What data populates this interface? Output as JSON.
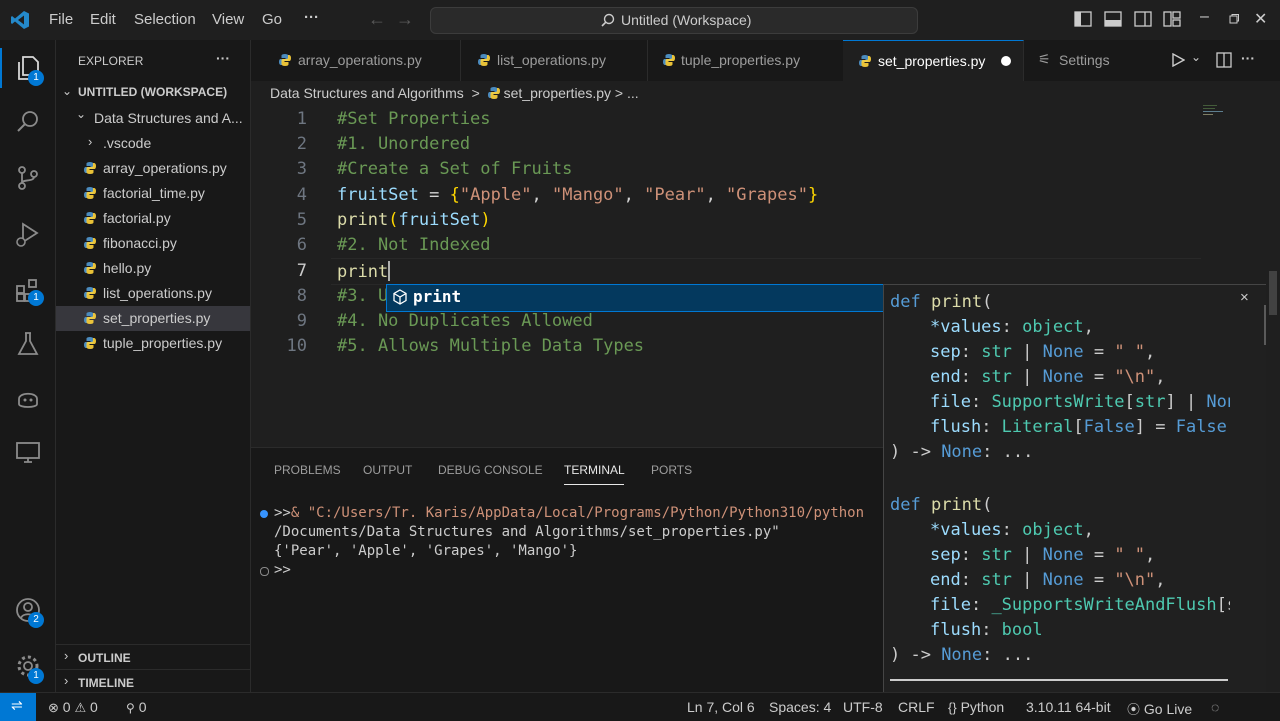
{
  "menu": {
    "file": "File",
    "edit": "Edit",
    "selection": "Selection",
    "view": "View",
    "go": "Go",
    "more": "···"
  },
  "command_center": {
    "text": "Untitled (Workspace)"
  },
  "activity_badges": {
    "explorer": "1",
    "extensions": "1",
    "accounts": "2",
    "manage": "1"
  },
  "sidebar": {
    "title": "EXPLORER",
    "more": "···",
    "workspace": "UNTITLED (WORKSPACE)",
    "folder": "Data Structures and A...",
    "items": [
      {
        "label": ".vscode"
      },
      {
        "label": "array_operations.py"
      },
      {
        "label": "factorial_time.py"
      },
      {
        "label": "factorial.py"
      },
      {
        "label": "fibonacci.py"
      },
      {
        "label": "hello.py"
      },
      {
        "label": "list_operations.py"
      },
      {
        "label": "set_properties.py"
      },
      {
        "label": "tuple_properties.py"
      }
    ],
    "outline": "OUTLINE",
    "timeline": "TIMELINE"
  },
  "tabs": [
    {
      "label": "array_operations.py"
    },
    {
      "label": "list_operations.py"
    },
    {
      "label": "tuple_properties.py"
    },
    {
      "label": "set_properties.py"
    },
    {
      "label": "Settings"
    }
  ],
  "breadcrumb": {
    "folder": "Data Structures and Algorithms",
    "sep": ">",
    "file": "set_properties.py",
    "tail": "> ..."
  },
  "editor": {
    "line_numbers": [
      "1",
      "2",
      "3",
      "4",
      "5",
      "6",
      "7",
      "8",
      "9",
      "10"
    ],
    "lines": {
      "l1": "#Set Properties",
      "l2": "#1. Unordered",
      "l3": "#Create a Set of Fruits",
      "l4_var": "fruitSet",
      "l4_eq": " = ",
      "l4_open": "{",
      "l4_s1": "\"Apple\"",
      "l4_s2": "\"Mango\"",
      "l4_s3": "\"Pear\"",
      "l4_s4": "\"Grapes\"",
      "l4_comma": ", ",
      "l4_close": "}",
      "l5_fn": "print",
      "l5_open": "(",
      "l5_arg": "fruitSet",
      "l5_close": ")",
      "l6": "#2. Not Indexed",
      "l7": "print",
      "l8": "#3. U",
      "l9": "#4. No Duplicates Allowed",
      "l10": "#5. Allows Multiple Data Types"
    },
    "suggestion": "print"
  },
  "hover": {
    "close": "×",
    "sig1": {
      "def": "def ",
      "name": "print",
      "open": "(",
      "p1a": "*values",
      "p1b": ": ",
      "p1c": "object",
      "p1d": ",",
      "p2a": "sep",
      "p2b": ": ",
      "p2c": "str",
      "p2d": " | ",
      "p2e": "None",
      "p2f": " = ",
      "p2g": "\" \"",
      "p2h": ",",
      "p3a": "end",
      "p3b": ": ",
      "p3c": "str",
      "p3d": " | ",
      "p3e": "None",
      "p3f": " = ",
      "p3g": "\"\\n\"",
      "p3h": ",",
      "p4a": "file",
      "p4b": ": ",
      "p4c": "SupportsWrite",
      "p4d": "[",
      "p4e": "str",
      "p4f": "] | ",
      "p4g": "Non",
      "p5a": "flush",
      "p5b": ": ",
      "p5c": "Literal",
      "p5d": "[",
      "p5e": "False",
      "p5f": "] = ",
      "p5g": "False",
      "ret1": ") -> ",
      "ret2": "None",
      "ret3": ": ..."
    },
    "sig2": {
      "def": "def ",
      "name": "print",
      "open": "(",
      "p1a": "*values",
      "p1b": ": ",
      "p1c": "object",
      "p1d": ",",
      "p2a": "sep",
      "p2b": ": ",
      "p2c": "str",
      "p2d": " | ",
      "p2e": "None",
      "p2f": " = ",
      "p2g": "\" \"",
      "p2h": ",",
      "p3a": "end",
      "p3b": ": ",
      "p3c": "str",
      "p3d": " | ",
      "p3e": "None",
      "p3f": " = ",
      "p3g": "\"\\n\"",
      "p3h": ",",
      "p4a": "file",
      "p4b": ": ",
      "p4c": "_SupportsWriteAndFlush",
      "p4d": "[s",
      "p5a": "flush",
      "p5b": ": ",
      "p5c": "bool",
      "ret1": ") -> ",
      "ret2": "None",
      "ret3": ": ..."
    }
  },
  "panel": {
    "tabs": [
      "PROBLEMS",
      "OUTPUT",
      "DEBUG CONSOLE",
      "TERMINAL",
      "PORTS"
    ],
    "terminal": {
      "prompt": ">>",
      "cmd1": "& \"C:/Users/Tr. Karis/AppData/Local/Programs/Python/Python310/python",
      "cmd2": "/Documents/Data Structures and Algorithms/set_properties.py\"",
      "out": "{'Pear', 'Apple', 'Grapes', 'Mango'}",
      "prompt2": ">>"
    }
  },
  "status": {
    "errors": "0",
    "warnings": "0",
    "ports": "0",
    "position": "Ln 7, Col 6",
    "spaces": "Spaces: 4",
    "encoding": "UTF-8",
    "eol": "CRLF",
    "language": "Python",
    "interpreter": "3.10.11 64-bit",
    "golive": "Go Live"
  },
  "colors": {
    "accent": "#0078d4",
    "comment": "#6a9955",
    "string": "#ce9178",
    "keyword": "#569cd6",
    "function": "#dcdcaa",
    "variable": "#9cdcfe",
    "type": "#4ec9b0"
  }
}
